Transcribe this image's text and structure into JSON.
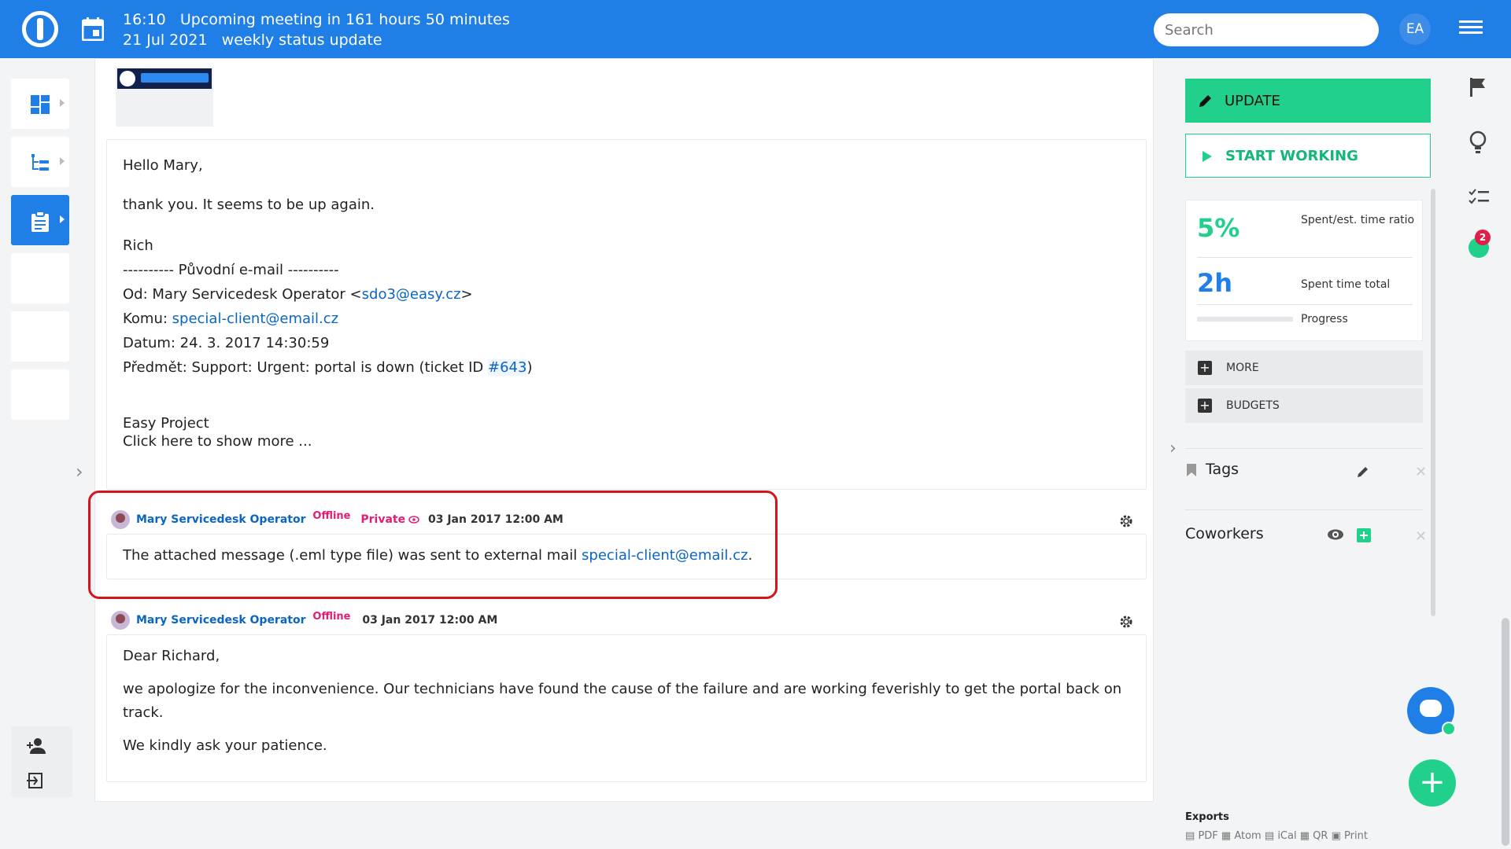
{
  "topbar": {
    "time": "16:10",
    "meeting_line": "Upcoming meeting in 161 hours 50 minutes",
    "date": "21 Jul 2021",
    "meeting_title": "weekly status update",
    "search_placeholder": "Search",
    "user_initials": "EA"
  },
  "email": {
    "greeting": "Hello Mary,",
    "line1": "thank you. It seems to be up again.",
    "signature": "Rich",
    "original_sep": "---------- Původní e-mail ----------",
    "from_label": "Od: Mary Servicedesk Operator <",
    "from_email": "sdo3@easy.cz",
    "from_end": ">",
    "to_label": "Komu: ",
    "to_email": "special-client@email.cz",
    "date_line": "Datum: 24. 3. 2017 14:30:59",
    "subject_label": "Předmět: Support: Urgent: portal is down (ticket ID ",
    "ticket_id": "#643",
    "subject_end": ")",
    "easy_project": "Easy Project",
    "show_more": "Click here to show more ..."
  },
  "comments": [
    {
      "author": "Mary Servicedesk Operator",
      "status": "Offline",
      "private": "Private",
      "date": "03 Jan 2017 12:00 AM",
      "text": "The attached message (.eml type file) was sent to external mail ",
      "email": "special-client@email.cz",
      "text_end": "."
    },
    {
      "author": "Mary Servicedesk Operator",
      "status": "Offline",
      "date": "03 Jan 2017 12:00 AM",
      "greeting": "Dear Richard,",
      "line1": "we apologize for the inconvenience. Our technicians have found the cause of the failure and are working feverishly to get the portal back on",
      "line1b": "track.",
      "line2": "We kindly ask your patience."
    }
  ],
  "sidebar": {
    "update_label": "UPDATE",
    "start_label": "START WORKING",
    "ratio_value": "5%",
    "ratio_label": "Spent/est. time ratio",
    "spent_value": "2h",
    "spent_label": "Spent time total",
    "progress_label": "Progress",
    "progress_fraction": 0,
    "more_label": "MORE",
    "budgets_label": "BUDGETS",
    "tags_label": "Tags",
    "coworkers_label": "Coworkers",
    "exports_label": "Exports",
    "export_links": [
      "PDF",
      "Atom",
      "iCal",
      "QR",
      "Print"
    ]
  },
  "notifications": {
    "timer_count": "2"
  },
  "colors": {
    "brand_blue": "#1f7fe6",
    "accent_green": "#21d18b",
    "alert_pink": "#e11d74",
    "highlight_red": "#d7141d"
  }
}
